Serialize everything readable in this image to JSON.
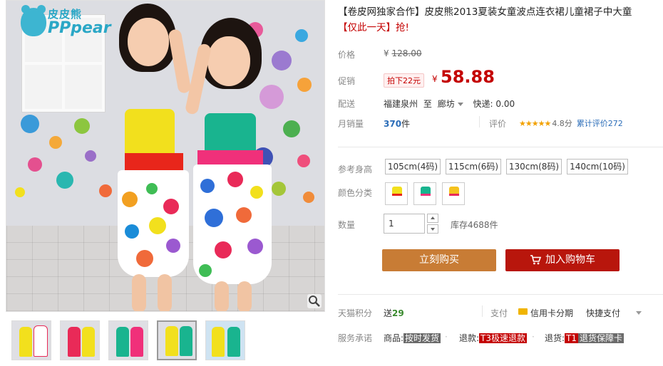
{
  "product": {
    "title_main": "【卷皮网独家合作】皮皮熊2013夏装女童波点连衣裙儿童裙子中大童",
    "title_promo": "【仅此一天】抢!"
  },
  "brand_logo": {
    "cn": "皮皮熊",
    "en": "PPpear",
    "reg": "®"
  },
  "price": {
    "original_label": "价格",
    "original_currency": "¥",
    "original_value": "128.00",
    "promo_label": "促销",
    "promo_badge": "拍下22元",
    "promo_currency": "¥",
    "promo_value": "58.88"
  },
  "shipping": {
    "label": "配送",
    "from": "福建泉州",
    "to_word": "至",
    "destination": "廊坊",
    "fee": "快递: 0.00"
  },
  "sales": {
    "label": "月销量",
    "count": "370",
    "unit": "件",
    "rating_label": "评价",
    "stars": "★★★★★",
    "score": "4.8分",
    "total_reviews": "累计评价272"
  },
  "size": {
    "label": "参考身高",
    "options": [
      "105cm(4码)",
      "115cm(6码)",
      "130cm(8码)",
      "140cm(10码)"
    ]
  },
  "color": {
    "label": "颜色分类",
    "swatches": [
      {
        "name": "yellow-dress",
        "color": "#f2e01d"
      },
      {
        "name": "green-dress",
        "color": "#19b48f"
      },
      {
        "name": "yellow-dress-2",
        "color": "#f5c21d"
      }
    ]
  },
  "quantity": {
    "label": "数量",
    "value": "1",
    "stock": "库存4688件"
  },
  "actions": {
    "buy_now": "立刻购买",
    "add_to_cart": "加入购物车"
  },
  "points": {
    "label": "天猫积分",
    "prefix": "送",
    "value": "29"
  },
  "payment": {
    "label": "支付",
    "option1": "信用卡分期",
    "option2": "快捷支付"
  },
  "service": {
    "label": "服务承诺",
    "item1_prefix": "商品:",
    "item1_tag": "按时发货",
    "item2_prefix": "退款:",
    "item2_tag": "T3极速退款",
    "item3_prefix": "退货:",
    "item3_tag_code": "T1",
    "item3_tag": "退货保障卡"
  },
  "gallery": {
    "thumbnail_count": 5,
    "active_index": 3
  },
  "colors": {
    "price_red": "#c40000",
    "buy_button": "#c87c35",
    "cart_button": "#b8160c",
    "link_blue": "#2a6cb8"
  }
}
